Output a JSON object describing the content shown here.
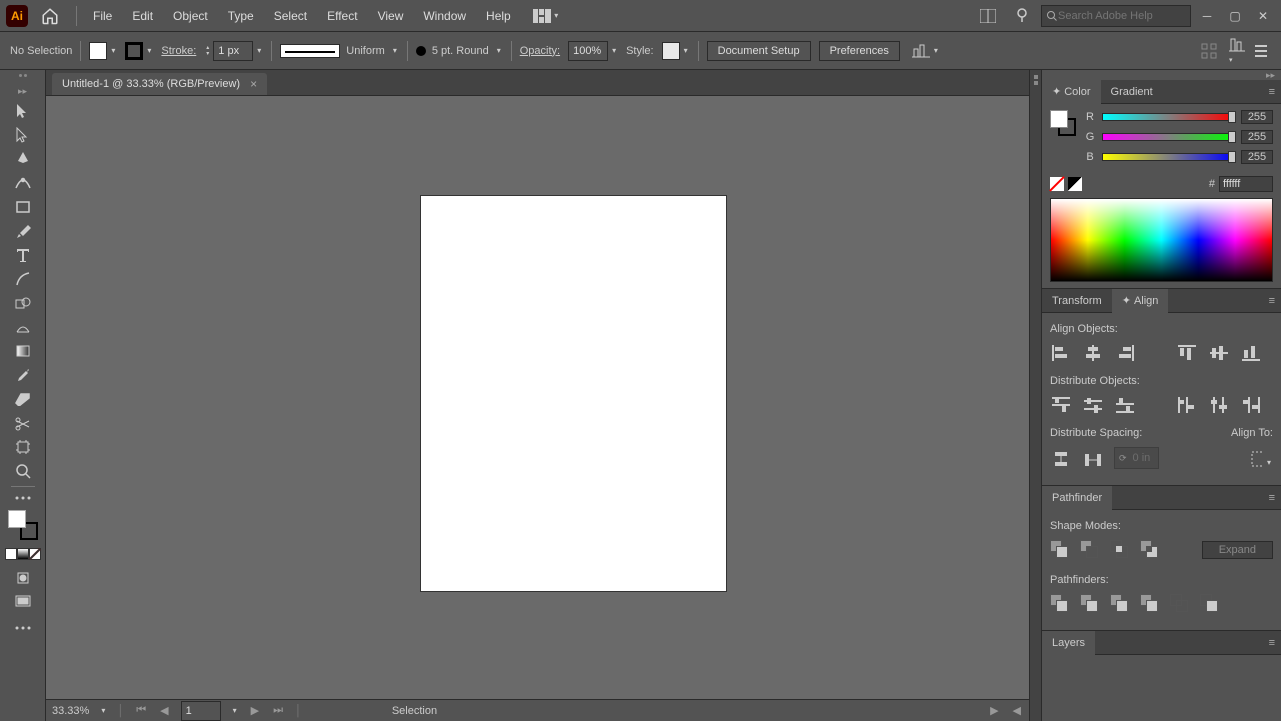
{
  "menu": {
    "items": [
      "File",
      "Edit",
      "Object",
      "Type",
      "Select",
      "Effect",
      "View",
      "Window",
      "Help"
    ]
  },
  "search": {
    "placeholder": "Search Adobe Help"
  },
  "control": {
    "selection": "No Selection",
    "stroke_label": "Stroke:",
    "stroke_value": "1 px",
    "brush_label": "Uniform",
    "point_label": "5 pt. Round",
    "opacity_label": "Opacity:",
    "opacity_value": "100%",
    "style_label": "Style:",
    "doc_setup": "Document Setup",
    "preferences": "Preferences"
  },
  "tab": {
    "title": "Untitled-1 @ 33.33% (RGB/Preview)"
  },
  "status": {
    "zoom": "33.33%",
    "page": "1",
    "tool": "Selection"
  },
  "color": {
    "tab_color": "Color",
    "tab_gradient": "Gradient",
    "r": "255",
    "g": "255",
    "b": "255",
    "r_label": "R",
    "g_label": "G",
    "b_label": "B",
    "hash": "#",
    "hex": "ffffff"
  },
  "align": {
    "tab_transform": "Transform",
    "tab_align": "Align",
    "align_objects": "Align Objects:",
    "distribute_objects": "Distribute Objects:",
    "distribute_spacing": "Distribute Spacing:",
    "align_to": "Align To:",
    "spacing_value": "0 in"
  },
  "pathfinder": {
    "tab": "Pathfinder",
    "shape_modes": "Shape Modes:",
    "pathfinders": "Pathfinders:",
    "expand": "Expand"
  },
  "layers": {
    "tab": "Layers"
  }
}
